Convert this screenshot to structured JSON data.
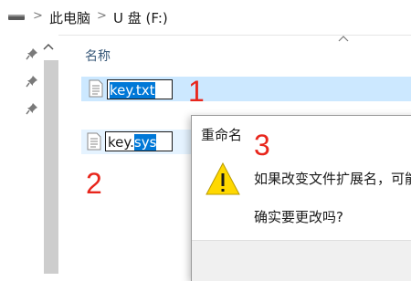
{
  "breadcrumb": {
    "items": [
      "此电脑",
      "U 盘 (F:)"
    ],
    "separator": ">"
  },
  "file_list": {
    "column_name": "名称",
    "rows": [
      {
        "name_prefix": "",
        "name_selected": "key.txt",
        "icon": "text-file-icon",
        "state": "selected-renaming"
      },
      {
        "name_prefix": "key.",
        "name_selected": "sys",
        "icon": "text-file-icon",
        "state": "renaming"
      }
    ]
  },
  "annotations": {
    "one": "1",
    "two": "2",
    "three": "3"
  },
  "rename_dialog": {
    "title": "重命名",
    "message": "如果改变文件扩展名，可能",
    "question": "确实要更改吗?",
    "icon": "warning-icon"
  },
  "colors": {
    "selection_blue": "#0078d7",
    "row_selected": "#cce8ff",
    "annotation_red": "#e8261c",
    "warning_yellow": "#ffd800"
  }
}
